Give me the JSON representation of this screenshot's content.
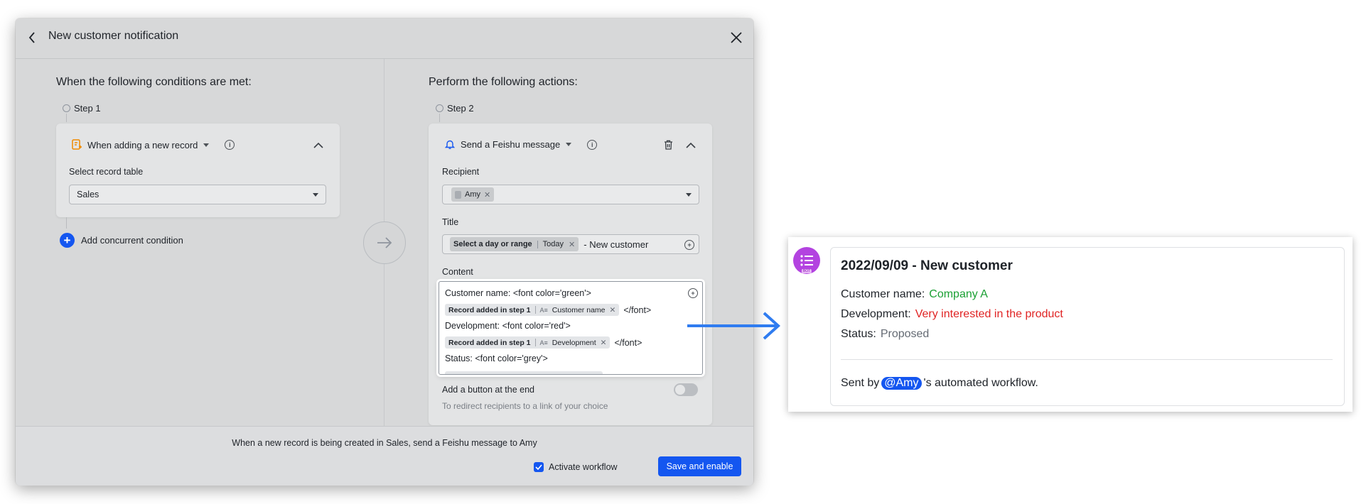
{
  "modal": {
    "title": "New customer notification",
    "left": {
      "heading": "When the following conditions are met:",
      "step": "Step 1",
      "trigger_label": "When adding a new record",
      "field_label": "Select record table",
      "table_value": "Sales",
      "add_condition": "Add concurrent condition"
    },
    "right": {
      "heading": "Perform the following actions:",
      "step": "Step 2",
      "action_label": "Send a Feishu message",
      "recipient_label": "Recipient",
      "recipient_tag": "Amy",
      "title_label": "Title",
      "title_tag_key": "Select a day or range",
      "title_tag_value": "Today",
      "title_suffix": "- New customer",
      "content_label": "Content",
      "content_lines": {
        "l1": "Customer name: <font color='green'>",
        "tag1_step": "Record added in step 1",
        "tag1_field": "Customer name",
        "l2_close": "</font>",
        "l3": "Development: <font color='red'>",
        "tag2_step": "Record added in step 1",
        "tag2_field": "Development",
        "l4_close": "</font>",
        "l5": "Status:  <font color='grey'>"
      },
      "button_label": "Add a button at the end",
      "button_hint": "To redirect recipients to a link of your choice"
    },
    "footer": {
      "summary": "When a new record is being created in Sales, send a Feishu message to Amy",
      "activate_label": "Activate workflow",
      "save_label": "Save and enable"
    }
  },
  "preview": {
    "avatar_badge": "BOT",
    "title": "2022/09/09 - New customer",
    "rows": [
      {
        "label": "Customer name:",
        "value": "Company A"
      },
      {
        "label": "Development:",
        "value": "Very interested in the product"
      },
      {
        "label": "Status:",
        "value": "Proposed"
      }
    ],
    "footer_prefix": "Sent by",
    "mention": "@Amy",
    "footer_suffix": "'s automated workflow."
  },
  "colors": {
    "accent": "#1456f0",
    "green": "#1aa033",
    "red": "#e02424",
    "grey": "#646a73",
    "bot": "#b343e0"
  }
}
